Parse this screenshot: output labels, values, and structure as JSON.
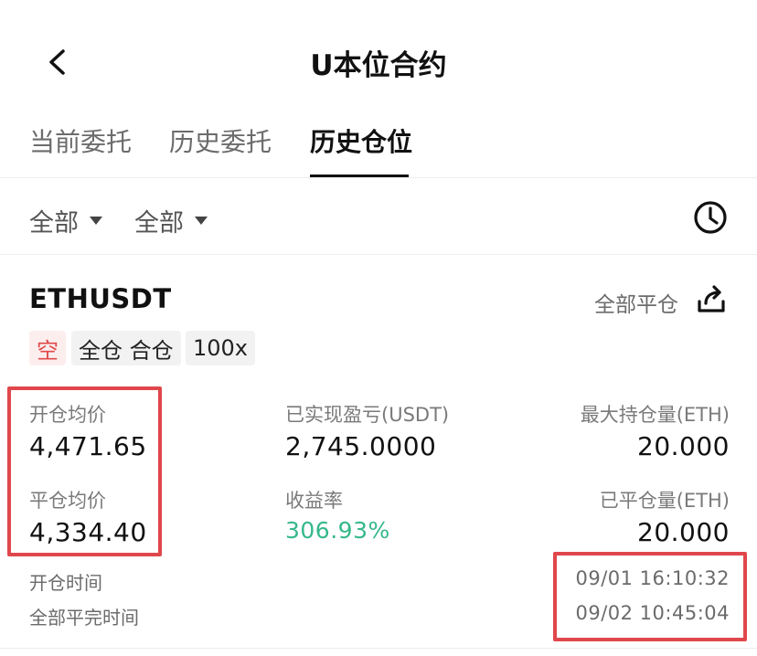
{
  "header": {
    "title": "U本位合约"
  },
  "tabs": [
    {
      "label": "当前委托"
    },
    {
      "label": "历史委托"
    },
    {
      "label": "历史仓位"
    }
  ],
  "filters": [
    {
      "label": "全部"
    },
    {
      "label": "全部"
    }
  ],
  "position": {
    "symbol": "ETHUSDT",
    "close_all_label": "全部平仓",
    "badges": [
      "空",
      "全仓 合仓",
      "100x"
    ],
    "fields": {
      "open_avg_price": {
        "label": "开仓均价",
        "value": "4,471.65"
      },
      "realized_pnl": {
        "label": "已实现盈亏(USDT)",
        "value": "2,745.0000"
      },
      "max_position": {
        "label": "最大持仓量(ETH)",
        "value": "20.000"
      },
      "close_avg_price": {
        "label": "平仓均价",
        "value": "4,334.40"
      },
      "roi": {
        "label": "收益率",
        "value": "306.93%"
      },
      "closed_qty": {
        "label": "已平仓量(ETH)",
        "value": "20.000"
      }
    },
    "times": {
      "open_time": {
        "label": "开仓时间",
        "value": "09/01 16:10:32"
      },
      "close_time": {
        "label": "全部平完时间",
        "value": "09/02 10:45:04"
      }
    }
  },
  "colors": {
    "highlight": "#e0474c",
    "profit": "#35b88a",
    "short": "#e04b4b"
  }
}
